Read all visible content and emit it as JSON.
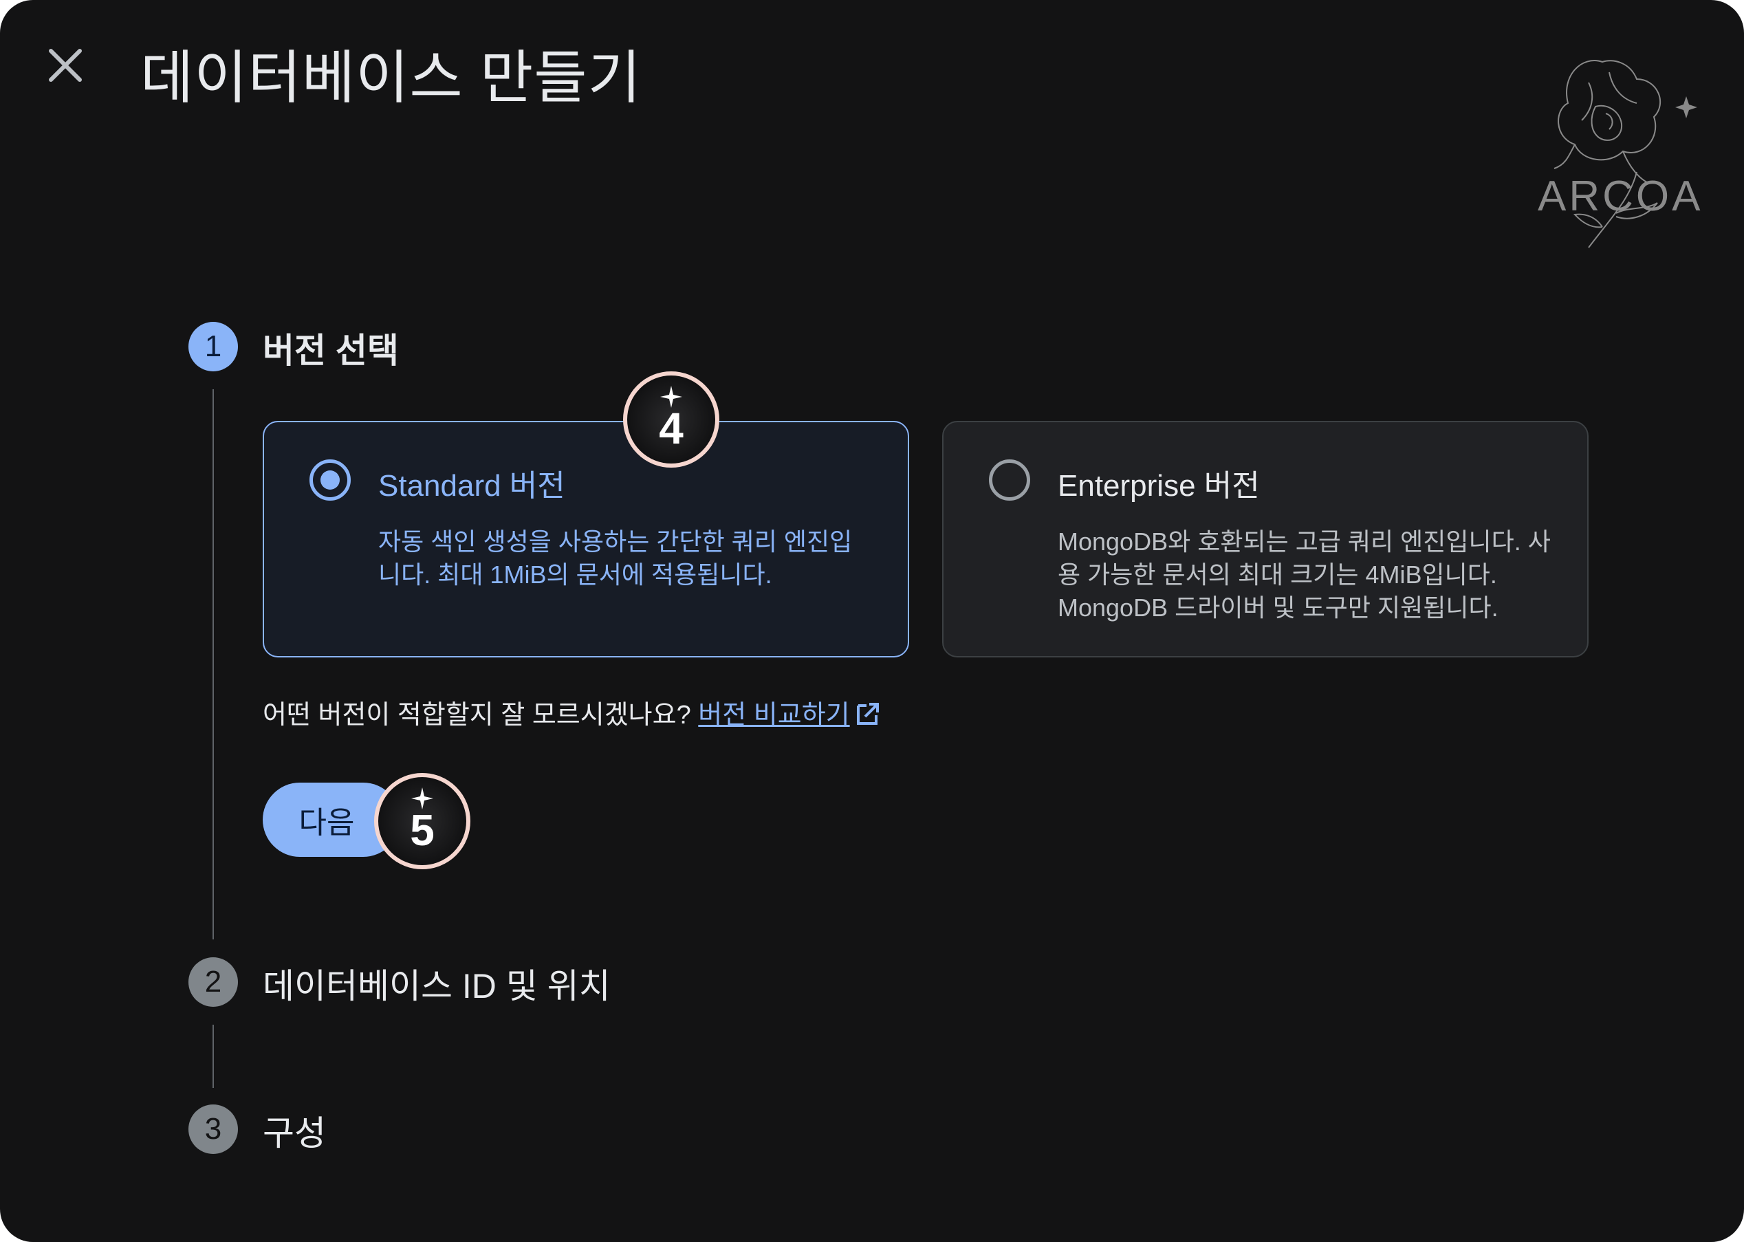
{
  "dialog": {
    "title": "데이터베이스 만들기",
    "close_icon": "close-icon"
  },
  "watermark": {
    "text": "ARCOA",
    "icon": "peony-flower-icon"
  },
  "steps": [
    {
      "number": "1",
      "label": "버전 선택",
      "state": "active"
    },
    {
      "number": "2",
      "label": "데이터베이스 ID 및 위치",
      "state": "inactive"
    },
    {
      "number": "3",
      "label": "구성",
      "state": "inactive"
    }
  ],
  "editions": {
    "standard": {
      "title": "Standard 버전",
      "description": "자동 색인 생성을 사용하는 간단한 쿼리 엔진입니다. 최대 1MiB의 문서에 적용됩니다.",
      "selected": true
    },
    "enterprise": {
      "title": "Enterprise 버전",
      "description": "MongoDB와 호환되는 고급 쿼리 엔진입니다. 사용 가능한 문서의 최대 크기는 4MiB입니다. MongoDB 드라이버 및 도구만 지원됩니다.",
      "selected": false
    }
  },
  "help": {
    "question": "어떤 버전이 적합할지 잘 모르시겠나요?",
    "link_label": "버전 비교하기",
    "link_icon": "open-in-new-icon"
  },
  "next_button": {
    "label": "다음"
  },
  "badges": [
    {
      "number": "4",
      "icon": "sparkle-icon"
    },
    {
      "number": "5",
      "icon": "sparkle-icon"
    }
  ],
  "colors": {
    "background": "#131314",
    "accent": "#8ab4f8",
    "badge_ring": "#f6d6cf"
  }
}
